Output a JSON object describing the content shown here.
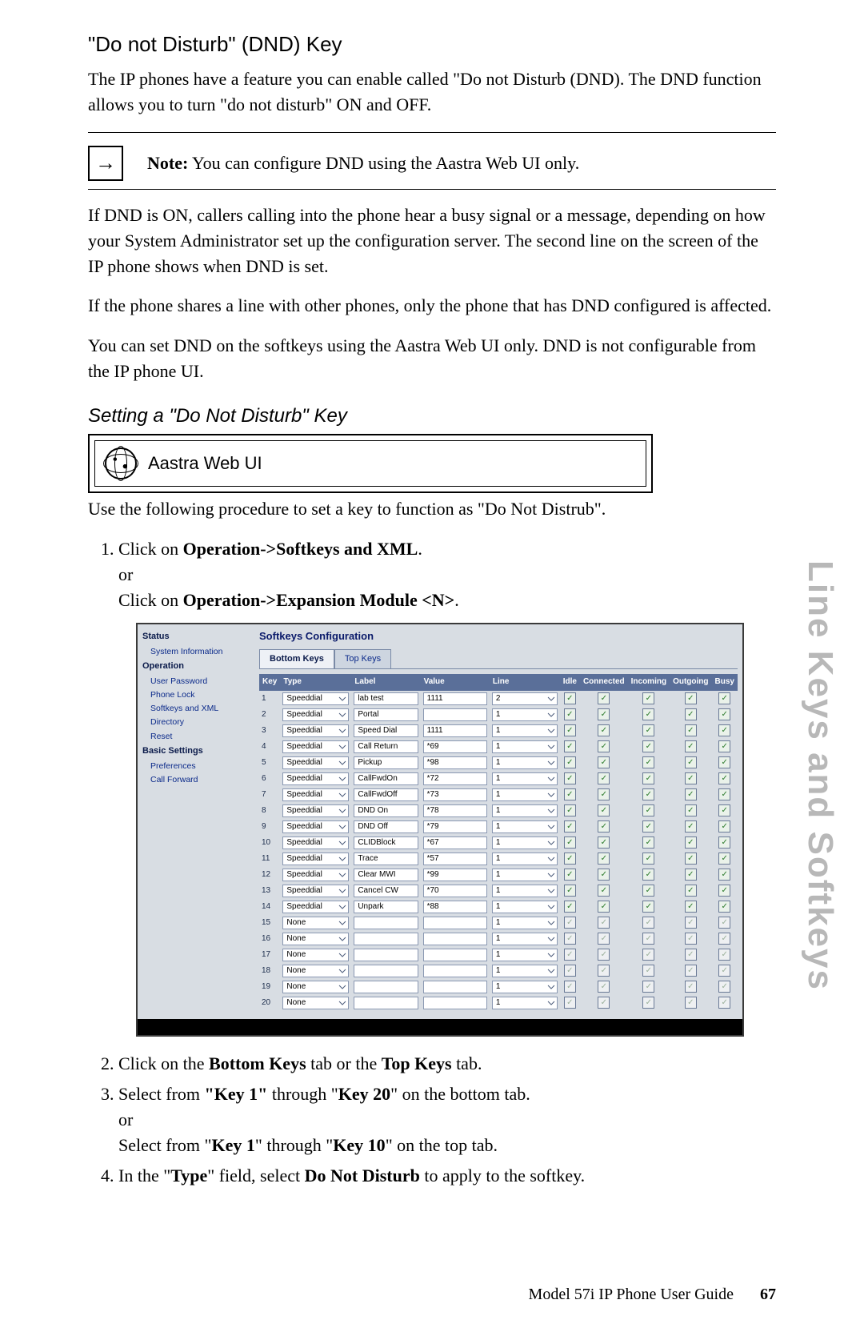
{
  "heading": "\"Do not Disturb\" (DND) Key",
  "p1": "The IP phones have a feature you can enable called \"Do not Disturb (DND). The DND function allows you to turn \"do not disturb\" ON and OFF.",
  "note_label": "Note:",
  "note_text": " You can configure DND using the Aastra Web UI only.",
  "p2": "If DND is ON, callers calling into the phone hear a busy signal or a message, depending on how your System Administrator set up the configuration server. The second line on the screen of the IP phone shows when DND is set.",
  "p3": "If the phone shares a line with other phones, only the phone that has DND configured is affected.",
  "p4": "You can set DND on the softkeys using the Aastra Web UI only. DND is not configurable from the IP phone UI.",
  "subhead": "Setting a \"Do Not Disturb\" Key",
  "ui_label": "Aastra Web UI",
  "intro": "Use the following procedure to set a key to function as \"Do Not Distrub\".",
  "step1_a": "Click on ",
  "step1_b": "Operation->Softkeys and XML",
  "step1_c": ".",
  "or": "or",
  "step1_d": "Click on ",
  "step1_e": "Operation->Expansion Module <N>",
  "step1_f": ".",
  "step2_a": "Click on the ",
  "step2_b": "Bottom Keys",
  "step2_c": " tab or the ",
  "step2_d": "Top Keys",
  "step2_e": " tab.",
  "step3_a": "Select from ",
  "step3_b": "\"Key 1\"",
  "step3_c": " through \"",
  "step3_d": "Key 20",
  "step3_e": "\" on the bottom tab.",
  "step3_f": "Select from \"",
  "step3_g": "Key 1",
  "step3_h": "\" through \"",
  "step3_i": "Key 10",
  "step3_j": "\" on the top tab.",
  "step4_a": "In the \"",
  "step4_b": "Type",
  "step4_c": "\" field, select ",
  "step4_d": "Do Not Disturb",
  "step4_e": " to apply to the softkey.",
  "sidebar": {
    "status": "Status",
    "sysinfo": "System Information",
    "operation": "Operation",
    "userpw": "User Password",
    "phonelock": "Phone Lock",
    "softkeys": "Softkeys and XML",
    "directory": "Directory",
    "reset": "Reset",
    "basic": "Basic Settings",
    "prefs": "Preferences",
    "callfwd": "Call Forward"
  },
  "cfg": {
    "title": "Softkeys Configuration",
    "tab_bottom": "Bottom Keys",
    "tab_top": "Top Keys",
    "cols": [
      "Key",
      "Type",
      "Label",
      "Value",
      "Line",
      "Idle",
      "Connected",
      "Incoming",
      "Outgoing",
      "Busy"
    ],
    "rows": [
      {
        "n": "1",
        "type": "Speeddial",
        "label": "lab test",
        "value": "1111",
        "line": "2",
        "en": true
      },
      {
        "n": "2",
        "type": "Speeddial",
        "label": "Portal",
        "value": "",
        "line": "1",
        "en": true
      },
      {
        "n": "3",
        "type": "Speeddial",
        "label": "Speed Dial",
        "value": "1111",
        "line": "1",
        "en": true
      },
      {
        "n": "4",
        "type": "Speeddial",
        "label": "Call Return",
        "value": "*69",
        "line": "1",
        "en": true
      },
      {
        "n": "5",
        "type": "Speeddial",
        "label": "Pickup",
        "value": "*98",
        "line": "1",
        "en": true
      },
      {
        "n": "6",
        "type": "Speeddial",
        "label": "CallFwdOn",
        "value": "*72",
        "line": "1",
        "en": true
      },
      {
        "n": "7",
        "type": "Speeddial",
        "label": "CallFwdOff",
        "value": "*73",
        "line": "1",
        "en": true
      },
      {
        "n": "8",
        "type": "Speeddial",
        "label": "DND On",
        "value": "*78",
        "line": "1",
        "en": true
      },
      {
        "n": "9",
        "type": "Speeddial",
        "label": "DND Off",
        "value": "*79",
        "line": "1",
        "en": true
      },
      {
        "n": "10",
        "type": "Speeddial",
        "label": "CLIDBlock",
        "value": "*67",
        "line": "1",
        "en": true
      },
      {
        "n": "11",
        "type": "Speeddial",
        "label": "Trace",
        "value": "*57",
        "line": "1",
        "en": true
      },
      {
        "n": "12",
        "type": "Speeddial",
        "label": "Clear MWI",
        "value": "*99",
        "line": "1",
        "en": true
      },
      {
        "n": "13",
        "type": "Speeddial",
        "label": "Cancel CW",
        "value": "*70",
        "line": "1",
        "en": true
      },
      {
        "n": "14",
        "type": "Speeddial",
        "label": "Unpark",
        "value": "*88",
        "line": "1",
        "en": true
      },
      {
        "n": "15",
        "type": "None",
        "label": "",
        "value": "",
        "line": "1",
        "en": false
      },
      {
        "n": "16",
        "type": "None",
        "label": "",
        "value": "",
        "line": "1",
        "en": false
      },
      {
        "n": "17",
        "type": "None",
        "label": "",
        "value": "",
        "line": "1",
        "en": false
      },
      {
        "n": "18",
        "type": "None",
        "label": "",
        "value": "",
        "line": "1",
        "en": false
      },
      {
        "n": "19",
        "type": "None",
        "label": "",
        "value": "",
        "line": "1",
        "en": false
      },
      {
        "n": "20",
        "type": "None",
        "label": "",
        "value": "",
        "line": "1",
        "en": false
      }
    ]
  },
  "side_tab": "Line Keys and Softkeys",
  "footer_text": "Model 57i IP Phone User Guide",
  "footer_page": "67"
}
